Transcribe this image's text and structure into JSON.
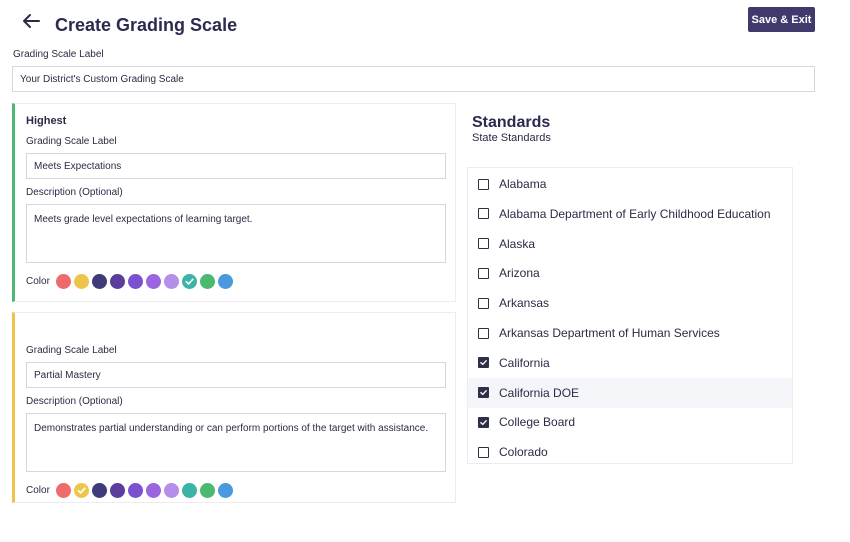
{
  "header": {
    "title": "Create Grading Scale",
    "save_label": "Save & Exit"
  },
  "scale": {
    "label": "Grading Scale Label",
    "value": "Your District's Custom Grading Scale"
  },
  "levels": [
    {
      "heading": "Highest",
      "label_caption": "Grading Scale Label",
      "label_value": "Meets Expectations",
      "description_caption": "Description (Optional)",
      "description_value": "Meets grade level expectations of learning target.",
      "color_caption": "Color",
      "accent": "#4cb870",
      "selected_color_index": 7
    },
    {
      "heading": "",
      "label_caption": "Grading Scale Label",
      "label_value": "Partial Mastery",
      "description_caption": "Description (Optional)",
      "description_value": "Demonstrates partial understanding or can perform portions of the target with assistance.",
      "color_caption": "Color",
      "accent": "#eec54a",
      "selected_color_index": 1
    }
  ],
  "palette": [
    "#ef6b6b",
    "#eec54a",
    "#3f3a7a",
    "#5a3e9e",
    "#7a52cf",
    "#9966e0",
    "#b48ee8",
    "#3bb3a6",
    "#4cb870",
    "#4a98dd"
  ],
  "standards": {
    "title": "Standards",
    "subtitle": "State Standards",
    "items": [
      {
        "label": "Alabama",
        "checked": false
      },
      {
        "label": "Alabama Department of Early Childhood Education",
        "checked": false
      },
      {
        "label": "Alaska",
        "checked": false
      },
      {
        "label": "Arizona",
        "checked": false
      },
      {
        "label": "Arkansas",
        "checked": false
      },
      {
        "label": "Arkansas Department of Human Services",
        "checked": false
      },
      {
        "label": "California",
        "checked": true
      },
      {
        "label": "California DOE",
        "checked": true
      },
      {
        "label": "College Board",
        "checked": true
      },
      {
        "label": "Colorado",
        "checked": false
      }
    ]
  }
}
